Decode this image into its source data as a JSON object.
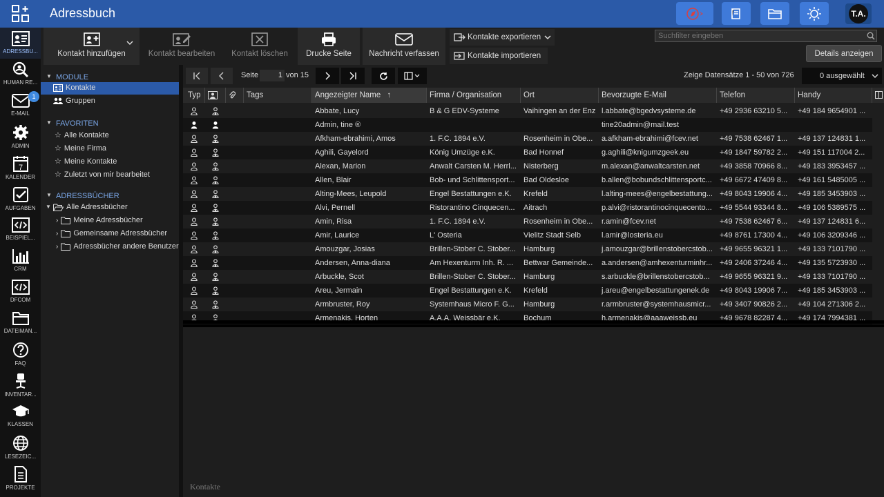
{
  "app": {
    "title": "Adressbuch",
    "user_initials": "T.A."
  },
  "topbar_icons": [
    "compass-icon",
    "book-icon",
    "folder-icon",
    "sun-icon"
  ],
  "apps": [
    {
      "label": "ADRESSBU...",
      "icon": "addressbook-icon",
      "active": true
    },
    {
      "label": "HUMAN RE...",
      "icon": "search-person-icon"
    },
    {
      "label": "E-MAIL",
      "icon": "mail-icon",
      "badge": "1"
    },
    {
      "label": "ADMIN",
      "icon": "gear-icon"
    },
    {
      "label": "KALENDER",
      "icon": "calendar-icon"
    },
    {
      "label": "AUFGABEN",
      "icon": "checkbox-icon"
    },
    {
      "label": "BEISPIEL...",
      "icon": "code-icon"
    },
    {
      "label": "CRM",
      "icon": "bar-chart-icon"
    },
    {
      "label": "DFCOM",
      "icon": "code-icon"
    },
    {
      "label": "DATEIMAN...",
      "icon": "folder-icon"
    },
    {
      "label": "FAQ",
      "icon": "question-icon"
    },
    {
      "label": "INVENTAR...",
      "icon": "chair-icon"
    },
    {
      "label": "KLASSEN",
      "icon": "graduation-cap-icon"
    },
    {
      "label": "LESEZEIC...",
      "icon": "globe-icon"
    },
    {
      "label": "PROJEKTE",
      "icon": "document-icon"
    }
  ],
  "calendar_day": "7",
  "toolbar": {
    "add": "Kontakt hinzufügen",
    "edit": "Kontakt bearbeiten",
    "delete": "Kontakt löschen",
    "print": "Drucke Seite",
    "message": "Nachricht verfassen",
    "export": "Kontakte exportieren",
    "import": "Kontakte importieren",
    "search_placeholder": "Suchfilter eingeben",
    "details": "Details anzeigen"
  },
  "tree": {
    "modules_header": "MODULE",
    "modules": [
      "Kontakte",
      "Gruppen"
    ],
    "favorites_header": "FAVORITEN",
    "favorites": [
      "Alle Kontakte",
      "Meine Firma",
      "Meine Kontakte",
      "Zuletzt von mir bearbeitet"
    ],
    "books_header": "ADRESSBÜCHER",
    "books_root": "Alle Adressbücher",
    "books": [
      "Meine Adressbücher",
      "Gemeinsame Adressbücher",
      "Adressbücher andere Benutzer"
    ]
  },
  "pager": {
    "page_label": "Seite",
    "page": "1",
    "of_label": "von 15",
    "records": "Zeige Datensätze 1 - 50 von 726",
    "selected": "0 ausgewählt"
  },
  "columns": [
    "Typ",
    "",
    "",
    "Tags",
    "Angezeigter Name",
    "Firma / Organisation",
    "Ort",
    "Bevorzugte E-Mail",
    "Telefon",
    "Handy"
  ],
  "rows": [
    {
      "name": "Abbate, Lucy",
      "org": "B & G EDV-Systeme",
      "city": "Vaihingen an der Enz",
      "email": "l.abbate@bgedvsysteme.de",
      "phone": "+49 2936 63210 5...",
      "mobile": "+49 184 9654901 ..."
    },
    {
      "name": "Admin, tine ®",
      "org": "",
      "city": "",
      "email": "tine20admin@mail.test",
      "phone": "",
      "mobile": ""
    },
    {
      "name": "Afkham-ebrahimi, Amos",
      "org": "1. F.C. 1894 e.V.",
      "city": "Rosenheim in Obe...",
      "email": "a.afkham-ebrahimi@fcev.net",
      "phone": "+49 7538 62467 1...",
      "mobile": "+49 137 124831 1..."
    },
    {
      "name": "Aghili, Gayelord",
      "org": "König Umzüge e.K.",
      "city": "Bad Honnef",
      "email": "g.aghili@knigumzgeek.eu",
      "phone": "+49 1847 59782 2...",
      "mobile": "+49 151 117004 2..."
    },
    {
      "name": "Alexan, Marion",
      "org": "Anwalt Carsten M. Herrl...",
      "city": "Nisterberg",
      "email": "m.alexan@anwaltcarsten.net",
      "phone": "+49 3858 70966 8...",
      "mobile": "+49 183 3953457 ..."
    },
    {
      "name": "Allen, Blair",
      "org": "Bob- und Schlittensport...",
      "city": "Bad Oldesloe",
      "email": "b.allen@bobundschlittensportc...",
      "phone": "+49 6672 47409 8...",
      "mobile": "+49 161 5485005 ..."
    },
    {
      "name": "Alting-Mees, Leupold",
      "org": "Engel Bestattungen e.K.",
      "city": "Krefeld",
      "email": "l.alting-mees@engelbestattung...",
      "phone": "+49 8043 19906 4...",
      "mobile": "+49 185 3453903 ..."
    },
    {
      "name": "Alvi, Pernell",
      "org": "Ristorantino Cinquecen...",
      "city": "Aitrach",
      "email": "p.alvi@ristorantinocinquecento...",
      "phone": "+49 5544 93344 8...",
      "mobile": "+49 106 5389575 ..."
    },
    {
      "name": "Amin, Risa",
      "org": "1. F.C. 1894 e.V.",
      "city": "Rosenheim in Obe...",
      "email": "r.amin@fcev.net",
      "phone": "+49 7538 62467 6...",
      "mobile": "+49 137 124831 6..."
    },
    {
      "name": "Amir, Laurice",
      "org": "L' Osteria",
      "city": "Vielitz Stadt Selb",
      "email": "l.amir@losteria.eu",
      "phone": "+49 8761 17300 4...",
      "mobile": "+49 106 3209346 ..."
    },
    {
      "name": "Amouzgar, Josias",
      "org": "Brillen-Stober C. Stober...",
      "city": "Hamburg",
      "email": "j.amouzgar@brillenstobercstob...",
      "phone": "+49 9655 96321 1...",
      "mobile": "+49 133 7101790 ..."
    },
    {
      "name": "Andersen, Anna-diana",
      "org": "Am Hexenturm Inh. R. ...",
      "city": "Bettwar Gemeinde...",
      "email": "a.andersen@amhexenturminhr...",
      "phone": "+49 2406 37246 4...",
      "mobile": "+49 135 5723930 ..."
    },
    {
      "name": "Arbuckle, Scot",
      "org": "Brillen-Stober C. Stober...",
      "city": "Hamburg",
      "email": "s.arbuckle@brillenstobercstob...",
      "phone": "+49 9655 96321 9...",
      "mobile": "+49 133 7101790 ..."
    },
    {
      "name": "Areu, Jermain",
      "org": "Engel Bestattungen e.K.",
      "city": "Krefeld",
      "email": "j.areu@engelbestattungenek.de",
      "phone": "+49 8043 19906 7...",
      "mobile": "+49 185 3453903 ..."
    },
    {
      "name": "Armbruster, Roy",
      "org": "Systemhaus Micro F. G...",
      "city": "Hamburg",
      "email": "r.armbruster@systemhausmicr...",
      "phone": "+49 3407 90826 2...",
      "mobile": "+49 104 271306 2..."
    },
    {
      "name": "Armenakis, Horten",
      "org": "A.A.A. Weissbär e.K.",
      "city": "Bochum",
      "email": "h.armenakis@aaaweissb.eu",
      "phone": "+49 9678 82287 4...",
      "mobile": "+49 174 7994381 ..."
    }
  ],
  "detail_label": "Kontakte"
}
